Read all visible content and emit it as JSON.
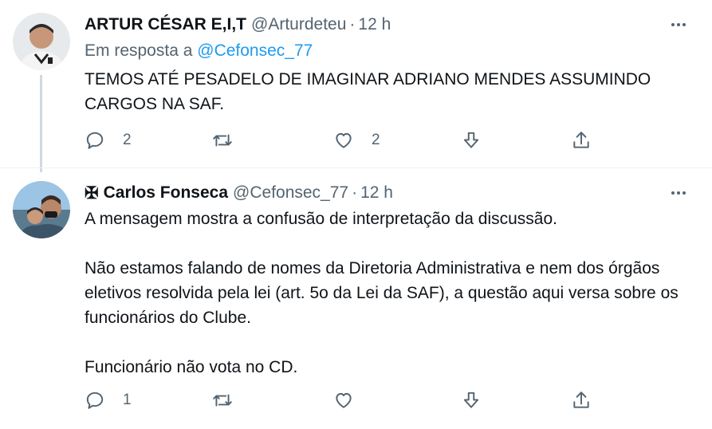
{
  "tweets": [
    {
      "name": "ARTUR CÉSAR E,I,T",
      "handle": "@Arturdeteu",
      "time": "12 h",
      "reply_prefix": "Em resposta a",
      "reply_to": "@Cefonsec_77",
      "text": "TEMOS ATÉ PESADELO DE IMAGINAR ADRIANO MENDES ASSUMINDO CARGOS NA SAF.",
      "replies": "2",
      "likes": "2"
    },
    {
      "prefix_symbol": "✠",
      "name": "Carlos Fonseca",
      "handle": "@Cefonsec_77",
      "time": "12 h",
      "paragraphs": [
        "A mensagem mostra a confusão de interpretação da discussão.",
        "Não estamos falando de nomes da Diretoria Administrativa e nem dos órgãos eletivos resolvida pela lei (art. 5o da Lei da SAF), a questão aqui versa sobre os funcionários do Clube.",
        "Funcionário não vota no CD."
      ],
      "replies": "1"
    }
  ],
  "icons": {
    "reply": "reply-icon",
    "retweet": "retweet-icon",
    "like": "heart-icon",
    "downvote": "downvote-icon",
    "share": "share-icon",
    "more": "more-icon"
  },
  "colors": {
    "link": "#1d9bf0",
    "secondary": "#536471",
    "text": "#0f1419"
  }
}
